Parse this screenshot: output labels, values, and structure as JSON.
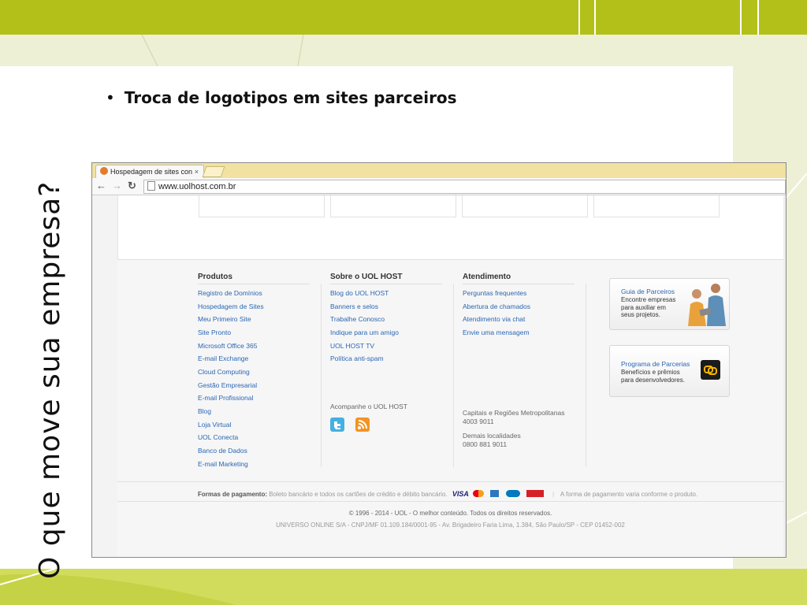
{
  "slide": {
    "vertical_title": "O que move sua empresa?",
    "bullet_text": "Troca de logotipos em sites parceiros"
  },
  "colors": {
    "top_band": "#b4c01a",
    "bottom_band": "#d2dc5c",
    "link_blue": "#2a66b4"
  },
  "browser": {
    "tab_title": "Hospedagem de sites con",
    "tab_close": "×",
    "url": "www.uolhost.com.br",
    "back_icon": "arrow-left",
    "forward_icon": "arrow-right",
    "reload_icon": "reload"
  },
  "footer": {
    "produtos": {
      "heading": "Produtos",
      "links": [
        "Registro de Domínios",
        "Hospedagem de Sites",
        "Meu Primeiro Site",
        "Site Pronto",
        "Microsoft Office 365",
        "E-mail Exchange",
        "Cloud Computing",
        "Gestão Empresarial",
        "E-mail Profissional",
        "Blog",
        "Loja Virtual",
        "UOL Conecta",
        "Banco de Dados",
        "E-mail Marketing"
      ]
    },
    "sobre": {
      "heading": "Sobre o UOL HOST",
      "links": [
        "Blog do UOL HOST",
        "Banners e selos",
        "Trabalhe Conosco",
        "Indique para um amigo",
        "UOL HOST TV",
        "Política anti-spam"
      ],
      "follow_label": "Acompanhe o UOL HOST"
    },
    "atendimento": {
      "heading": "Atendimento",
      "links": [
        "Perguntas frequentes",
        "Abertura de chamados",
        "Atendimento via chat",
        "Envie uma mensagem"
      ],
      "capitais_label": "Capitais e Regiões Metropolitanas",
      "capitais_phone": "4003 9011",
      "demais_label": "Demais localidades",
      "demais_phone": "0800 881 9011"
    },
    "guia": {
      "title": "Guia de Parceiros",
      "desc1": "Encontre empresas",
      "desc2": "para auxiliar em",
      "desc3": "seus projetos."
    },
    "programa": {
      "title": "Programa de Parcerias",
      "desc1": "Benefícios e prêmios",
      "desc2": "para desenvolvedores."
    },
    "payment_label": "Formas de pagamento:",
    "payment_text": "Boleto bancário e todos os cartões de crédito e débito bancário.",
    "visa_label": "VISA",
    "payment_note": "A forma de pagamento varia conforme o produto.",
    "copyright": "© 1996 - 2014 - UOL - O melhor conteúdo. Todos os direitos reservados.",
    "company": "UNIVERSO ONLINE S/A - CNPJ/MF 01.109.184/0001-95 - Av. Brigadeiro Faria Lima, 1.384, São Paulo/SP - CEP 01452-002"
  }
}
